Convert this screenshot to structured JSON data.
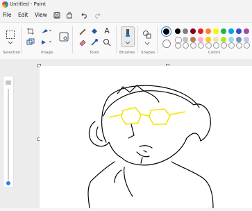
{
  "window": {
    "title": "Untitled - Paint"
  },
  "menu": {
    "file": "File",
    "edit": "Edit",
    "view": "View"
  },
  "ribbon": {
    "selection_label": "Selection",
    "image_label": "Image",
    "tools_label": "Tools",
    "brushes_label": "Brushes",
    "shapes_label": "Shapes",
    "colors_label": "Colors"
  },
  "colors": {
    "primary": "#000000",
    "secondary": "#ffffff",
    "palette_row1": [
      "#000000",
      "#7f7f7f",
      "#880015",
      "#ed1c24",
      "#ff7f27",
      "#fff200",
      "#22b14c",
      "#00a2e8",
      "#3f48cc",
      "#a349a4"
    ],
    "palette_row2": [
      "#ffffff",
      "#c3c3c3",
      "#b97a57",
      "#ffaec9",
      "#ffc90e",
      "#efe4b0",
      "#b5e61d",
      "#99d9ea",
      "#7092be",
      "#c8bfe7"
    ]
  },
  "drawing": {
    "line_color": "#000000",
    "glasses_color": "#f5e400"
  }
}
